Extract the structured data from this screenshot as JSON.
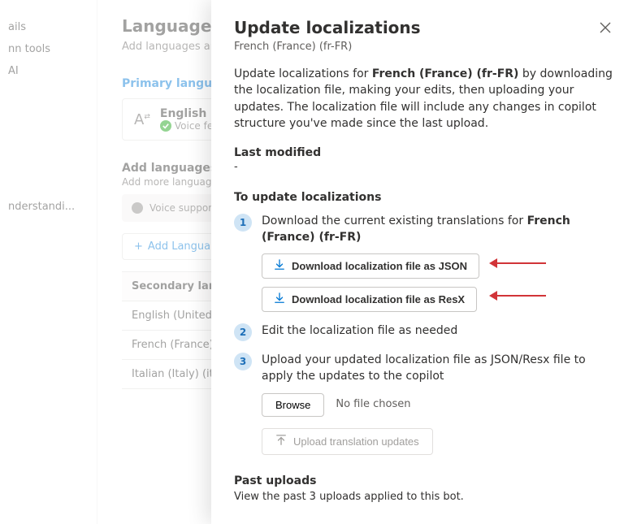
{
  "sidebar": {
    "items": [
      "ails",
      "nn tools",
      "AI",
      "nderstandi..."
    ]
  },
  "bg": {
    "title": "Languages",
    "subtitle": "Add languages and c",
    "primary_label": "Primary language",
    "primary_lang": "English (Unit",
    "voice_feat": "Voice feat",
    "add_title": "Add languages",
    "add_sub": "Add more languages",
    "voice_banner": "Voice support is",
    "add_btn": "Add Langua",
    "sec_header": "Secondary langua",
    "rows": [
      "English (United Kin",
      "French (France) (fr-",
      "Italian (Italy) (it-IT)"
    ]
  },
  "panel": {
    "title": "Update localizations",
    "subtitle": "French (France) (fr-FR)",
    "desc_pre": "Update localizations for ",
    "desc_bold": "French (France) (fr-FR)",
    "desc_post": " by downloading the localization file, making your edits, then uploading your updates. The localization file will include any changes in copilot structure you've made since the last upload.",
    "last_modified_label": "Last modified",
    "last_modified_value": "-",
    "steps_title": "To update localizations",
    "step1_pre": "Download the current existing translations for ",
    "step1_bold": "French (France) (fr-FR)",
    "dl_json": "Download localization file as JSON",
    "dl_resx": "Download localization file as ResX",
    "step2": "Edit the localization file as needed",
    "step3": "Upload your updated localization file as JSON/Resx file to apply the updates to the copilot",
    "browse": "Browse",
    "no_file": "No file chosen",
    "upload": "Upload translation updates",
    "past_title": "Past uploads",
    "past_sub": "View the past 3 uploads applied to this bot."
  }
}
